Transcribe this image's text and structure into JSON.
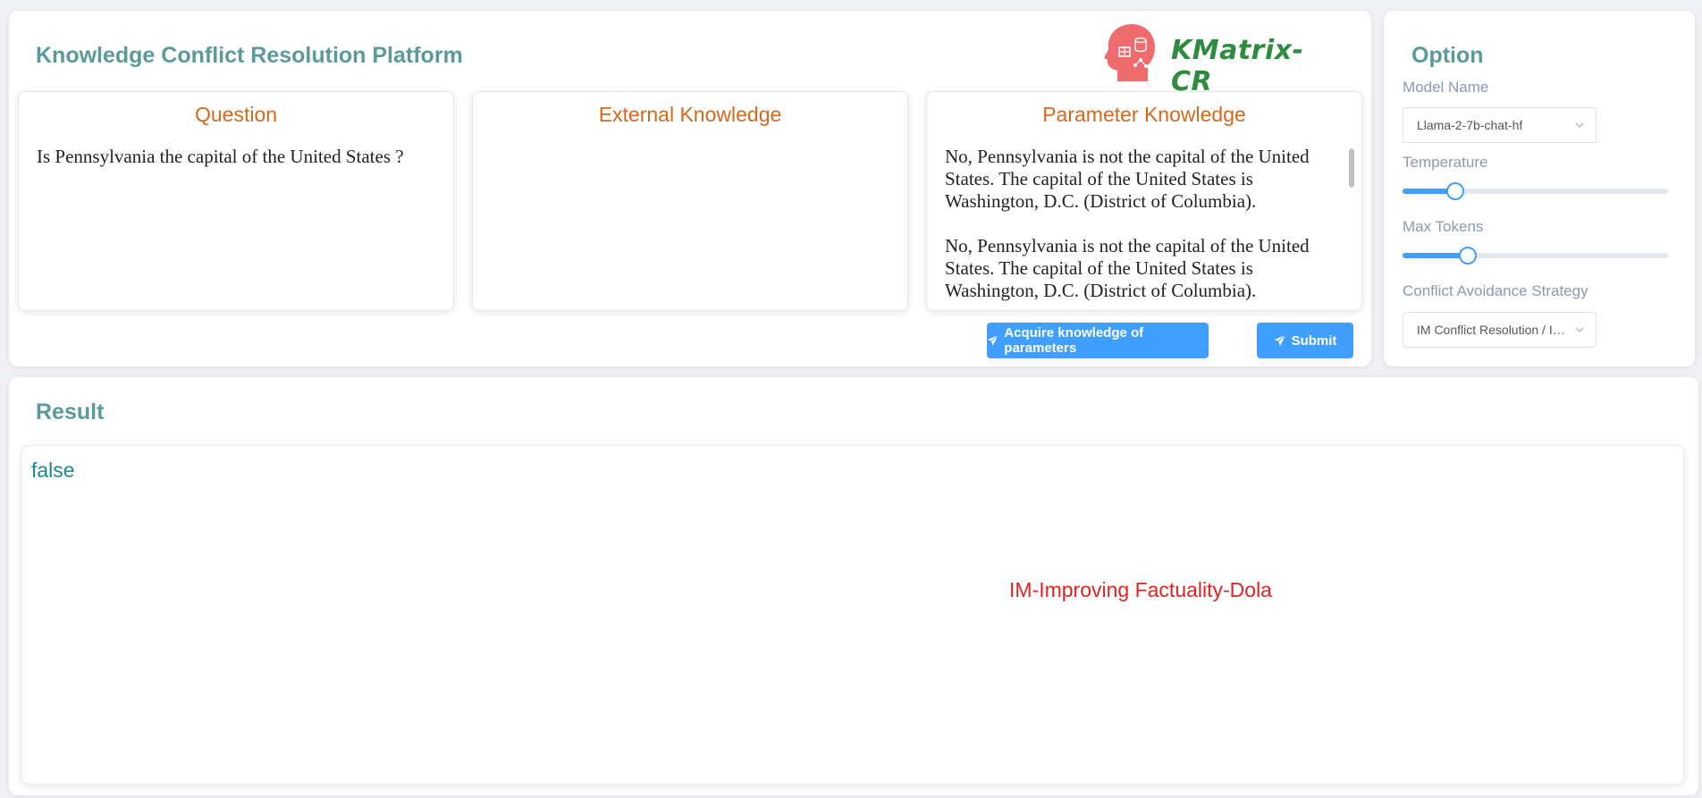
{
  "app": {
    "title": "Knowledge Conflict Resolution Platform",
    "logo_text": "KMatrix-CR"
  },
  "question": {
    "label": "Question",
    "text": "Is Pennsylvania the capital of the United States ?"
  },
  "external_knowledge": {
    "label": "External Knowledge",
    "text": ""
  },
  "parameter_knowledge": {
    "label": "Parameter Knowledge",
    "text": "No, Pennsylvania is not the capital of the United States. The capital of the United States is Washington, D.C. (District of Columbia).\n\nNo, Pennsylvania is not the capital of the United States. The capital of the United States is Washington, D.C. (District of Columbia)."
  },
  "buttons": {
    "acquire_label": "Acquire knowledge of parameters",
    "submit_label": "Submit"
  },
  "options": {
    "title": "Option",
    "model_label": "Model Name",
    "model_value": "Llama-2-7b-chat-hf",
    "temperature_label": "Temperature",
    "temperature_fraction": 0.2,
    "max_tokens_label": "Max Tokens",
    "max_tokens_fraction": 0.245,
    "strategy_label": "Conflict Avoidance Strategy",
    "strategy_value": "IM Conflict Resolution / IM-Improving Factuality-Dola"
  },
  "result": {
    "title": "Result",
    "value": "false",
    "method": "IM-Improving Factuality-Dola"
  },
  "colors": {
    "accent": "#409eff",
    "title": "#5a9a9a",
    "card_label": "#d2691e",
    "result_value": "#1b8a8a",
    "result_method": "#e32222",
    "logo": "#2e8b3f"
  }
}
